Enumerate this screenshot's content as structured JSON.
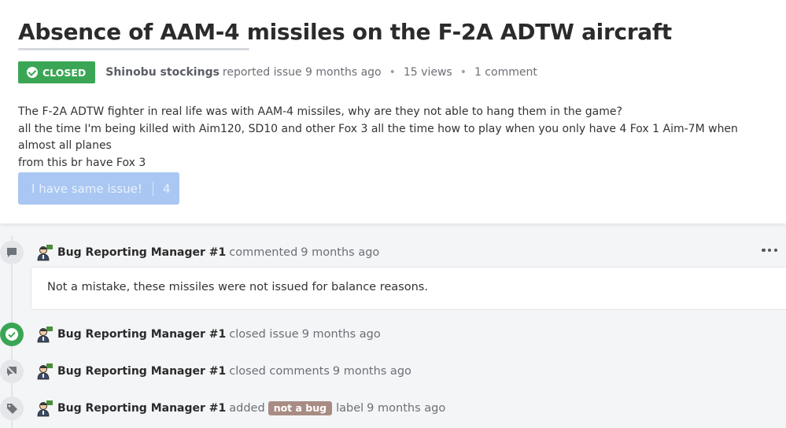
{
  "issue": {
    "title": "Absence of AAM-4 missiles on the F-2A ADTW aircraft",
    "status": "CLOSED",
    "author": "Shinobu stockings",
    "reported": "reported issue 9 months ago",
    "views": "15 views",
    "comments": "1 comment",
    "body_lines": [
      "The F-2A ADTW fighter in real life was with AAM-4 missiles, why are they not able to hang them in the game?",
      "all the time I'm being killed with Aim120, SD10 and other Fox 3 all the time how to play when you only have 4 Fox 1 Aim-7M when almost all planes",
      "from this br have Fox 3"
    ],
    "same_issue_label": "I have same issue!",
    "same_issue_count": "4"
  },
  "timeline": {
    "comment_event": {
      "user": "Bug Reporting Manager #1",
      "action": "commented",
      "time": "9 months ago",
      "text": "Not a mistake, these missiles were not issued for balance reasons."
    },
    "closed_issue": {
      "user": "Bug Reporting Manager #1",
      "action": "closed issue",
      "time": "9 months ago"
    },
    "closed_comments": {
      "user": "Bug Reporting Manager #1",
      "action": "closed comments",
      "time": "9 months ago"
    },
    "label_added": {
      "user": "Bug Reporting Manager #1",
      "action": "added",
      "label": "not a bug",
      "suffix": "label",
      "time": "9 months ago"
    }
  },
  "icons": {
    "status": "check-circle-icon",
    "comment": "speech-bubble-icon",
    "closed": "check-circle-icon",
    "comments_closed": "comment-off-icon",
    "label": "tag-icon",
    "more": "more-horizontal-icon",
    "avatar": "manager-avatar-icon"
  },
  "colors": {
    "closed_badge": "#3aa655",
    "button": "#a9c7f2",
    "label_pill": "#a88c84"
  }
}
